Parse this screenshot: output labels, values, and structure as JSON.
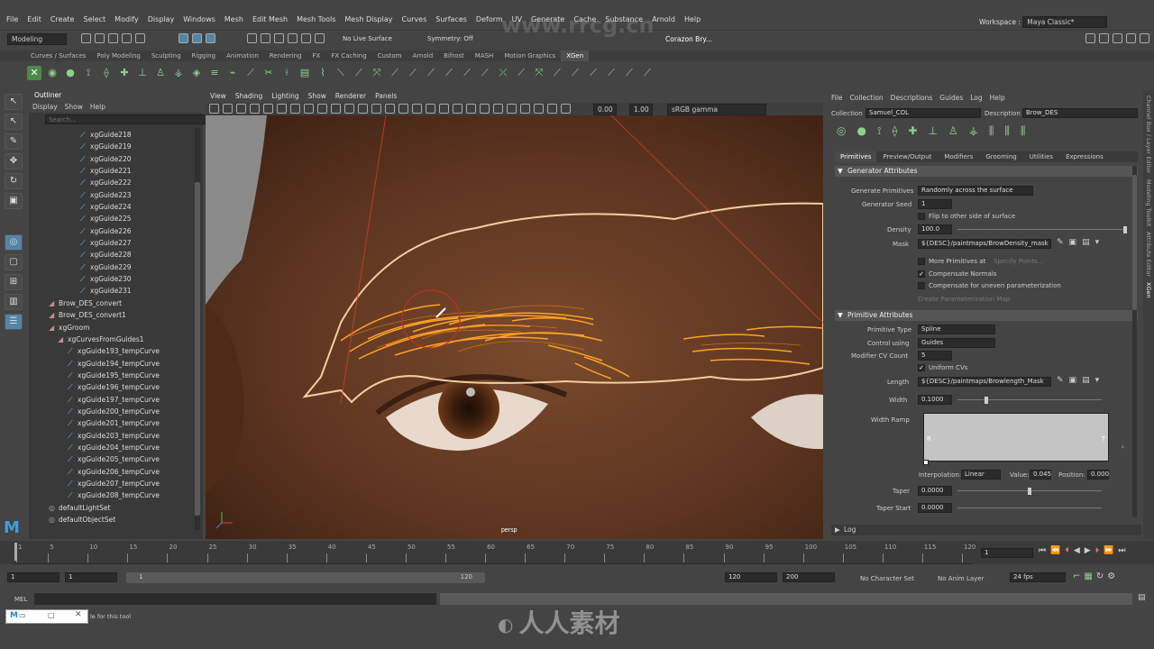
{
  "menubar": {
    "items": [
      "File",
      "Edit",
      "Create",
      "Select",
      "Modify",
      "Display",
      "Windows",
      "Mesh",
      "Edit Mesh",
      "Mesh Tools",
      "Mesh Display",
      "Curves",
      "Surfaces",
      "Deform",
      "UV",
      "Generate",
      "Cache",
      "Substance",
      "Arnold",
      "Help"
    ],
    "workspace_label": "Workspace :",
    "workspace_value": "Maya Classic*"
  },
  "statusline": {
    "mode": "Modeling",
    "live_surface": "No Live Surface",
    "symmetry": "Symmetry: Off",
    "user": "Corazon Bry..."
  },
  "shelf_tabs": [
    "Curves / Surfaces",
    "Poly Modeling",
    "Sculpting",
    "Rigging",
    "Animation",
    "Rendering",
    "FX",
    "FX Caching",
    "Custom",
    "Arnold",
    "Bifrost",
    "MASH",
    "Motion Graphics",
    "XGen"
  ],
  "shelf_active": "XGen",
  "outliner": {
    "title": "Outliner",
    "menu": [
      "Display",
      "Show",
      "Help"
    ],
    "search_placeholder": "Search...",
    "guides": [
      "xgGuide218",
      "xgGuide219",
      "xgGuide220",
      "xgGuide221",
      "xgGuide222",
      "xgGuide223",
      "xgGuide224",
      "xgGuide225",
      "xgGuide226",
      "xgGuide227",
      "xgGuide228",
      "xgGuide229",
      "xgGuide230",
      "xgGuide231"
    ],
    "convert": [
      "Brow_DES_convert",
      "Brow_DES_convert1"
    ],
    "groom": "xgGroom",
    "curves_group": "xgCurvesFromGuides1",
    "temp_curves": [
      "xgGuide193_tempCurve",
      "xgGuide194_tempCurve",
      "xgGuide195_tempCurve",
      "xgGuide196_tempCurve",
      "xgGuide197_tempCurve",
      "xgGuide200_tempCurve",
      "xgGuide201_tempCurve",
      "xgGuide203_tempCurve",
      "xgGuide204_tempCurve",
      "xgGuide205_tempCurve",
      "xgGuide206_tempCurve",
      "xgGuide207_tempCurve",
      "xgGuide208_tempCurve"
    ],
    "sets": [
      "defaultLightSet",
      "defaultObjectSet"
    ]
  },
  "viewport": {
    "menu": [
      "View",
      "Shading",
      "Lighting",
      "Show",
      "Renderer",
      "Panels"
    ],
    "field_a": "0.00",
    "field_b": "1.00",
    "color_space": "sRGB gamma",
    "camera": "persp"
  },
  "xgen": {
    "menu": [
      "File",
      "Collection",
      "Descriptions",
      "Guides",
      "Log",
      "Help"
    ],
    "collection_label": "Collection",
    "collection_value": "Samuel_COL",
    "description_label": "Description",
    "description_value": "Brow_DES",
    "tabs": [
      "Primitives",
      "Preview/Output",
      "Modifiers",
      "Grooming",
      "Utilities",
      "Expressions"
    ],
    "gen_header": "Generator Attributes",
    "generate_primitives_label": "Generate Primitives",
    "generate_primitives_value": "Randomly across the surface",
    "generator_seed_label": "Generator Seed",
    "generator_seed_value": "1",
    "flip_label": "Flip to other side of surface",
    "density_label": "Density",
    "density_value": "100.0",
    "mask_label": "Mask",
    "mask_value": "${DESC}/paintmaps/BrowDensity_mask",
    "more_primitives_label": "More Primitives at",
    "specify_points": "Specify Points...",
    "compensate_normals": "Compensate Normals",
    "compensate_uneven": "Compensate for uneven parameterization",
    "create_param_map": "Create Parameterization Map",
    "prim_header": "Primitive Attributes",
    "primitive_type_label": "Primitive Type",
    "primitive_type_value": "Spline",
    "control_using_label": "Control using",
    "control_using_value": "Guides",
    "modifier_cv_label": "Modifier CV Count",
    "modifier_cv_value": "5",
    "uniform_cvs": "Uniform CVs",
    "length_label": "Length",
    "length_value": "${DESC}/paintmaps/Browlength_Mask",
    "width_label": "Width",
    "width_value": "0.1000",
    "width_ramp_label": "Width Ramp",
    "ramp_r": "R",
    "ramp_t": "T",
    "interpolation_label": "Interpolation:",
    "interpolation_value": "Linear",
    "ramp_value_label": "Value:",
    "ramp_value": "0.045",
    "ramp_position_label": "Position:",
    "ramp_position": "0.000",
    "taper_label": "Taper",
    "taper_value": "0.0000",
    "taper_start_label": "Taper Start",
    "taper_start_value": "0.0000",
    "log_label": "Log",
    "density_slider": 1.0,
    "width_slider": 0.2,
    "taper_slider": 0.5
  },
  "side_tabs": [
    "Channel Box / Layer Editor",
    "Modeling Toolkit",
    "Attribute Editor",
    "XGen"
  ],
  "timeline": {
    "ticks": [
      "1",
      "5",
      "10",
      "15",
      "20",
      "25",
      "30",
      "35",
      "40",
      "45",
      "50",
      "55",
      "60",
      "65",
      "70",
      "75",
      "80",
      "85",
      "90",
      "95",
      "100",
      "105",
      "110",
      "115",
      "120"
    ],
    "current_frame": "1"
  },
  "rangebar": {
    "start": "1",
    "inner_start": "1",
    "range_start_label": "1",
    "range_end_label": "120",
    "end": "120",
    "anim_end": "200",
    "character_set": "No Character Set",
    "anim_layer": "No Anim Layer",
    "fps": "24 fps"
  },
  "cmdline": {
    "lang": "MEL"
  },
  "helpline": {
    "text": "le for this tool"
  },
  "watermarks": [
    "www.rrcg.cn",
    "人人素材"
  ]
}
